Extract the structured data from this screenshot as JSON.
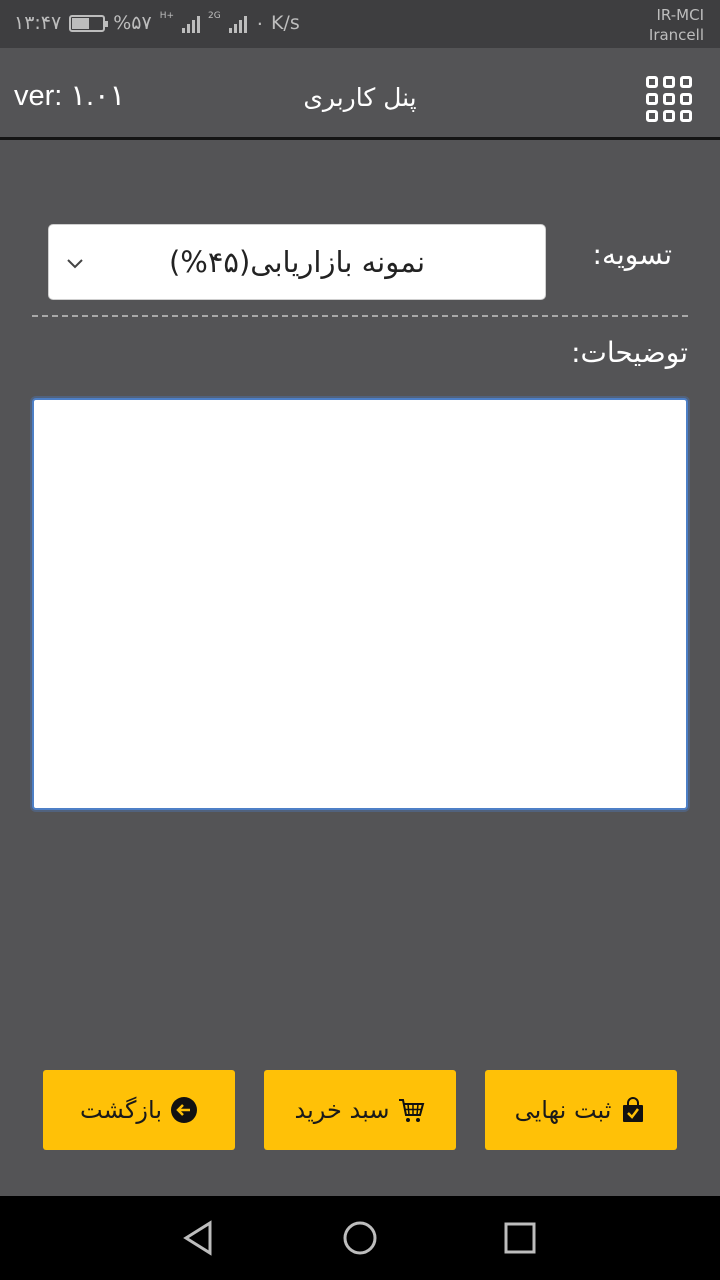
{
  "status_bar": {
    "time": "۱۳:۴۷",
    "battery_percent": "%۵۷",
    "battery_level": 0.57,
    "network_2g": "2G",
    "hplus": "H+",
    "speed": "۰ K/s",
    "carrier_1": "IR-MCI",
    "carrier_2": "Irancell"
  },
  "app_bar": {
    "version": "ver: ۱.۰۱",
    "title": "پنل کاربری",
    "menu_icon": "grid-icon"
  },
  "form": {
    "settlement_label": "تسویه:",
    "settlement_value": "نمونه بازاریابی(۴۵%)",
    "description_label": "توضیحات:",
    "description_value": ""
  },
  "buttons": {
    "back_label": "بازگشت",
    "back_icon": "arrow-left-circle-icon",
    "cart_label": "سبد خرید",
    "cart_icon": "cart-icon",
    "final_label": "ثبت نهایی",
    "final_icon": "bag-check-icon"
  },
  "nav_bar": {
    "back_icon": "triangle-back-icon",
    "home_icon": "circle-home-icon",
    "recents_icon": "square-recents-icon"
  },
  "colors": {
    "background": "#545456",
    "button": "#ffc107",
    "focus": "#4d7fc6"
  }
}
